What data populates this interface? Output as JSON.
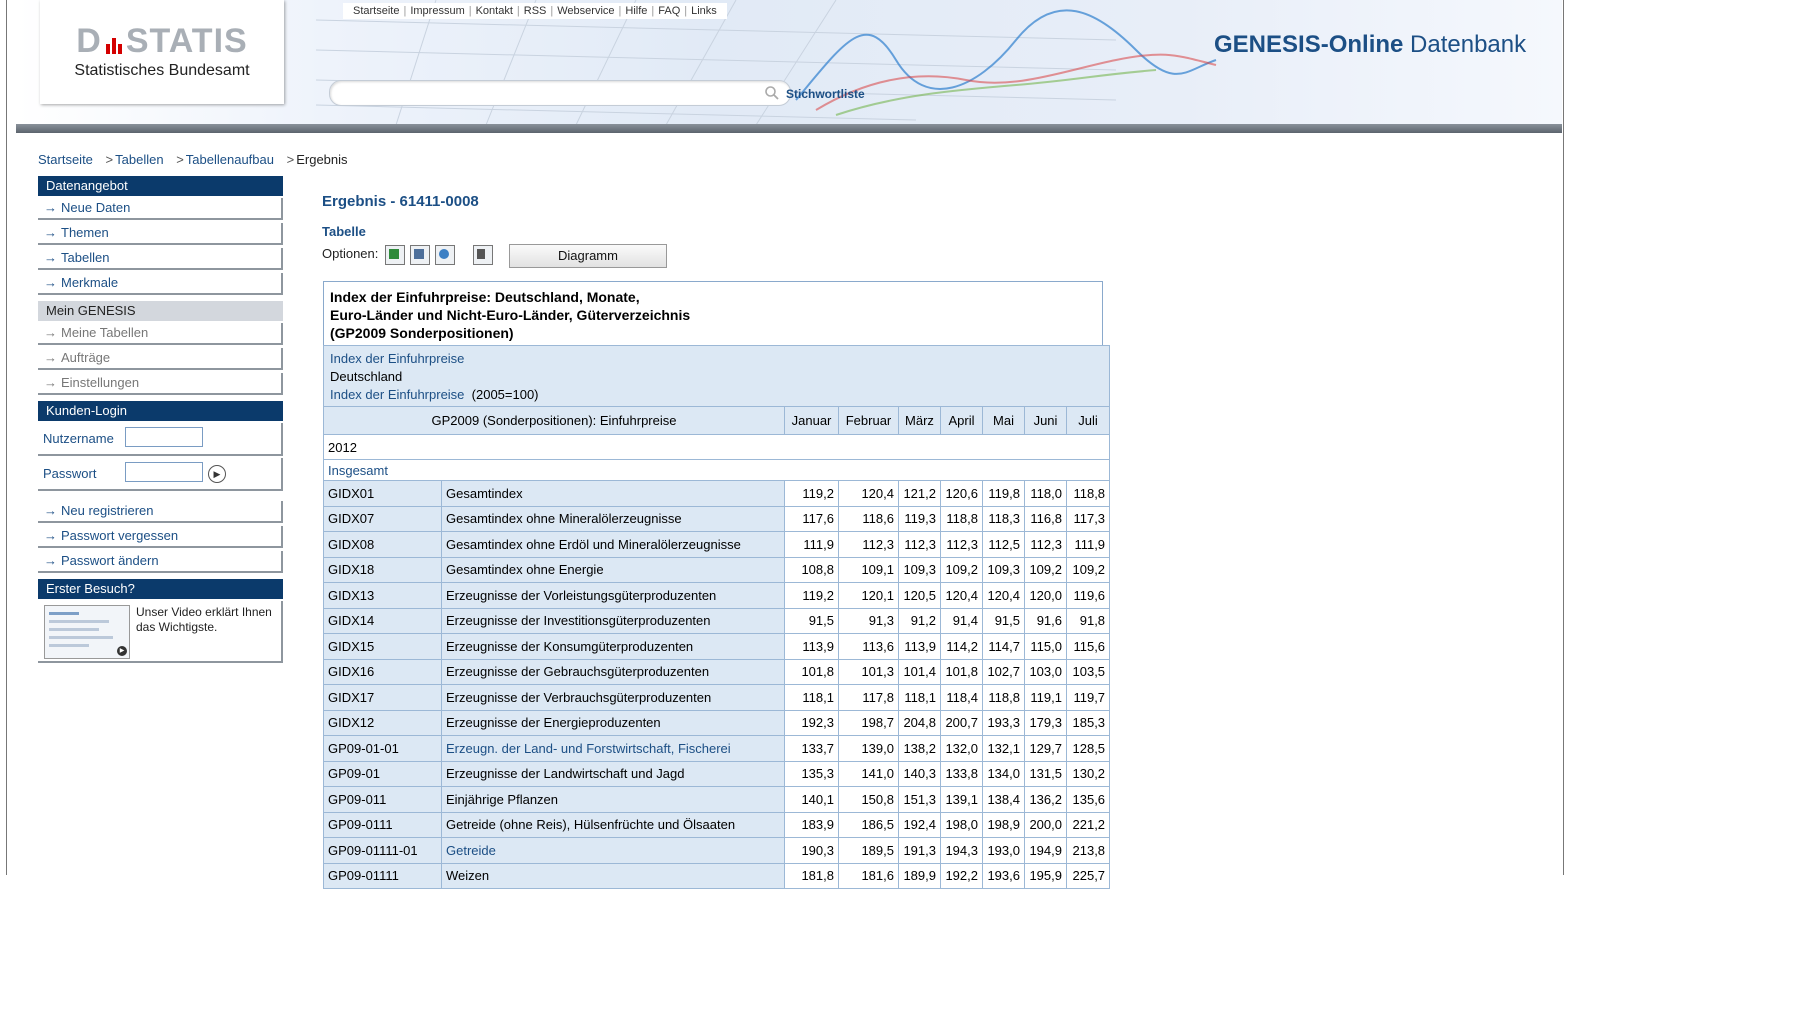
{
  "top_links": [
    "Startseite",
    "Impressum",
    "Kontakt",
    "RSS",
    "Webservice",
    "Hilfe",
    "FAQ",
    "Links"
  ],
  "logo": {
    "main": "DSTATIS",
    "left": "D",
    "right": "STATIS",
    "subtitle": "Statistisches Bundesamt"
  },
  "search": {
    "placeholder": "",
    "stichwort_label": "Stichwortliste"
  },
  "brand": {
    "bold": "GENESIS-Online",
    "rest": " Datenbank"
  },
  "breadcrumb": {
    "items": [
      "Startseite",
      "Tabellen",
      "Tabellenaufbau"
    ],
    "current": "Ergebnis"
  },
  "sidebar": {
    "datenangebot": {
      "title": "Datenangebot",
      "items": [
        "Neue Daten",
        "Themen",
        "Tabellen",
        "Merkmale"
      ]
    },
    "mein_genesis": {
      "title": "Mein GENESIS",
      "items": [
        "Meine Tabellen",
        "Aufträge",
        "Einstellungen"
      ]
    },
    "kunden_login": {
      "title": "Kunden-Login",
      "username_label": "Nutzername",
      "password_label": "Passwort",
      "links": [
        "Neu registrieren",
        "Passwort vergessen",
        "Passwort ändern"
      ]
    },
    "erster_besuch": {
      "title": "Erster Besuch?",
      "text": "Unser Video erklärt Ihnen das Wichtigste."
    }
  },
  "main": {
    "title": "Ergebnis - 61411-0008",
    "tabelle_label": "Tabelle",
    "optionen_label": "Optionen:",
    "diagramm_button": "Diagramm",
    "table_title": [
      "Index der Einfuhrpreise: Deutschland, Monate,",
      "Euro-Länder und Nicht-Euro-Länder, Güterverzeichnis",
      "(GP2009 Sonderpositionen)"
    ],
    "info": {
      "line1": "Index der Einfuhrpreise",
      "line2": "Deutschland",
      "line3_link": "Index der Einfuhrpreise",
      "line3_unit": "(2005=100)"
    },
    "header_label": "GP2009 (Sonderpositionen): Einfuhrpreise",
    "months": [
      "Januar",
      "Februar",
      "März",
      "April",
      "Mai",
      "Juni",
      "Juli"
    ],
    "year": "2012",
    "group": "Insgesamt",
    "rows": [
      {
        "code": "GIDX01",
        "label": "Gesamtindex",
        "link": false,
        "values": [
          "119,2",
          "120,4",
          "121,2",
          "120,6",
          "119,8",
          "118,0",
          "118,8"
        ]
      },
      {
        "code": "GIDX07",
        "label": "Gesamtindex ohne Mineralölerzeugnisse",
        "link": false,
        "values": [
          "117,6",
          "118,6",
          "119,3",
          "118,8",
          "118,3",
          "116,8",
          "117,3"
        ]
      },
      {
        "code": "GIDX08",
        "label": "Gesamtindex ohne Erdöl und Mineralölerzeugnisse",
        "link": false,
        "values": [
          "111,9",
          "112,3",
          "112,3",
          "112,3",
          "112,5",
          "112,3",
          "111,9"
        ]
      },
      {
        "code": "GIDX18",
        "label": "Gesamtindex ohne Energie",
        "link": false,
        "values": [
          "108,8",
          "109,1",
          "109,3",
          "109,2",
          "109,3",
          "109,2",
          "109,2"
        ]
      },
      {
        "code": "GIDX13",
        "label": "Erzeugnisse der Vorleistungsgüterproduzenten",
        "link": false,
        "values": [
          "119,2",
          "120,1",
          "120,5",
          "120,4",
          "120,4",
          "120,0",
          "119,6"
        ]
      },
      {
        "code": "GIDX14",
        "label": "Erzeugnisse der Investitionsgüterproduzenten",
        "link": false,
        "values": [
          "91,5",
          "91,3",
          "91,2",
          "91,4",
          "91,5",
          "91,6",
          "91,8"
        ]
      },
      {
        "code": "GIDX15",
        "label": "Erzeugnisse der Konsumgüterproduzenten",
        "link": false,
        "values": [
          "113,9",
          "113,6",
          "113,9",
          "114,2",
          "114,7",
          "115,0",
          "115,6"
        ]
      },
      {
        "code": "GIDX16",
        "label": "Erzeugnisse der Gebrauchsgüterproduzenten",
        "link": false,
        "values": [
          "101,8",
          "101,3",
          "101,4",
          "101,8",
          "102,7",
          "103,0",
          "103,5"
        ]
      },
      {
        "code": "GIDX17",
        "label": "Erzeugnisse der Verbrauchsgüterproduzenten",
        "link": false,
        "values": [
          "118,1",
          "117,8",
          "118,1",
          "118,4",
          "118,8",
          "119,1",
          "119,7"
        ]
      },
      {
        "code": "GIDX12",
        "label": "Erzeugnisse der Energieproduzenten",
        "link": false,
        "values": [
          "192,3",
          "198,7",
          "204,8",
          "200,7",
          "193,3",
          "179,3",
          "185,3"
        ]
      },
      {
        "code": "GP09-01-01",
        "label": "Erzeugn. der Land- und Forstwirtschaft, Fischerei",
        "link": true,
        "values": [
          "133,7",
          "139,0",
          "138,2",
          "132,0",
          "132,1",
          "129,7",
          "128,5"
        ]
      },
      {
        "code": "GP09-01",
        "label": "Erzeugnisse der Landwirtschaft und Jagd",
        "link": false,
        "values": [
          "135,3",
          "141,0",
          "140,3",
          "133,8",
          "134,0",
          "131,5",
          "130,2"
        ]
      },
      {
        "code": "GP09-011",
        "label": "Einjährige Pflanzen",
        "link": false,
        "values": [
          "140,1",
          "150,8",
          "151,3",
          "139,1",
          "138,4",
          "136,2",
          "135,6"
        ]
      },
      {
        "code": "GP09-0111",
        "label": "Getreide (ohne Reis), Hülsenfrüchte und Ölsaaten",
        "link": false,
        "values": [
          "183,9",
          "186,5",
          "192,4",
          "198,0",
          "198,9",
          "200,0",
          "221,2"
        ]
      },
      {
        "code": "GP09-01111-01",
        "label": "Getreide",
        "link": true,
        "values": [
          "190,3",
          "189,5",
          "191,3",
          "194,3",
          "193,0",
          "194,9",
          "213,8"
        ]
      },
      {
        "code": "GP09-01111",
        "label": "Weizen",
        "link": false,
        "values": [
          "181,8",
          "181,6",
          "189,9",
          "192,2",
          "193,6",
          "195,9",
          "225,7"
        ]
      }
    ]
  },
  "colors": {
    "brand_blue": "#1c4f85",
    "nav_dark": "#0b3a6b",
    "table_cell": "#dce8f4",
    "logo_red": "#d40000"
  }
}
